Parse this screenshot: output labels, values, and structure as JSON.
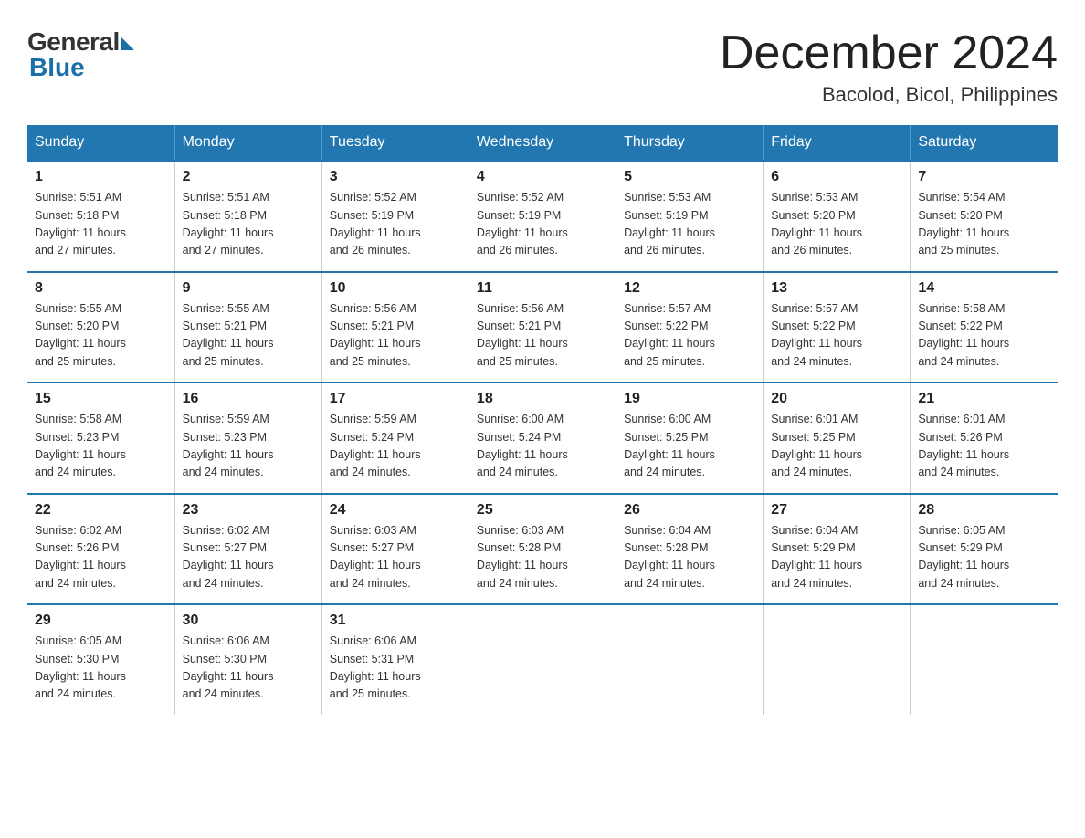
{
  "logo": {
    "general": "General",
    "blue": "Blue"
  },
  "title": "December 2024",
  "subtitle": "Bacolod, Bicol, Philippines",
  "headers": [
    "Sunday",
    "Monday",
    "Tuesday",
    "Wednesday",
    "Thursday",
    "Friday",
    "Saturday"
  ],
  "weeks": [
    [
      {
        "day": "1",
        "info": "Sunrise: 5:51 AM\nSunset: 5:18 PM\nDaylight: 11 hours\nand 27 minutes."
      },
      {
        "day": "2",
        "info": "Sunrise: 5:51 AM\nSunset: 5:18 PM\nDaylight: 11 hours\nand 27 minutes."
      },
      {
        "day": "3",
        "info": "Sunrise: 5:52 AM\nSunset: 5:19 PM\nDaylight: 11 hours\nand 26 minutes."
      },
      {
        "day": "4",
        "info": "Sunrise: 5:52 AM\nSunset: 5:19 PM\nDaylight: 11 hours\nand 26 minutes."
      },
      {
        "day": "5",
        "info": "Sunrise: 5:53 AM\nSunset: 5:19 PM\nDaylight: 11 hours\nand 26 minutes."
      },
      {
        "day": "6",
        "info": "Sunrise: 5:53 AM\nSunset: 5:20 PM\nDaylight: 11 hours\nand 26 minutes."
      },
      {
        "day": "7",
        "info": "Sunrise: 5:54 AM\nSunset: 5:20 PM\nDaylight: 11 hours\nand 25 minutes."
      }
    ],
    [
      {
        "day": "8",
        "info": "Sunrise: 5:55 AM\nSunset: 5:20 PM\nDaylight: 11 hours\nand 25 minutes."
      },
      {
        "day": "9",
        "info": "Sunrise: 5:55 AM\nSunset: 5:21 PM\nDaylight: 11 hours\nand 25 minutes."
      },
      {
        "day": "10",
        "info": "Sunrise: 5:56 AM\nSunset: 5:21 PM\nDaylight: 11 hours\nand 25 minutes."
      },
      {
        "day": "11",
        "info": "Sunrise: 5:56 AM\nSunset: 5:21 PM\nDaylight: 11 hours\nand 25 minutes."
      },
      {
        "day": "12",
        "info": "Sunrise: 5:57 AM\nSunset: 5:22 PM\nDaylight: 11 hours\nand 25 minutes."
      },
      {
        "day": "13",
        "info": "Sunrise: 5:57 AM\nSunset: 5:22 PM\nDaylight: 11 hours\nand 24 minutes."
      },
      {
        "day": "14",
        "info": "Sunrise: 5:58 AM\nSunset: 5:22 PM\nDaylight: 11 hours\nand 24 minutes."
      }
    ],
    [
      {
        "day": "15",
        "info": "Sunrise: 5:58 AM\nSunset: 5:23 PM\nDaylight: 11 hours\nand 24 minutes."
      },
      {
        "day": "16",
        "info": "Sunrise: 5:59 AM\nSunset: 5:23 PM\nDaylight: 11 hours\nand 24 minutes."
      },
      {
        "day": "17",
        "info": "Sunrise: 5:59 AM\nSunset: 5:24 PM\nDaylight: 11 hours\nand 24 minutes."
      },
      {
        "day": "18",
        "info": "Sunrise: 6:00 AM\nSunset: 5:24 PM\nDaylight: 11 hours\nand 24 minutes."
      },
      {
        "day": "19",
        "info": "Sunrise: 6:00 AM\nSunset: 5:25 PM\nDaylight: 11 hours\nand 24 minutes."
      },
      {
        "day": "20",
        "info": "Sunrise: 6:01 AM\nSunset: 5:25 PM\nDaylight: 11 hours\nand 24 minutes."
      },
      {
        "day": "21",
        "info": "Sunrise: 6:01 AM\nSunset: 5:26 PM\nDaylight: 11 hours\nand 24 minutes."
      }
    ],
    [
      {
        "day": "22",
        "info": "Sunrise: 6:02 AM\nSunset: 5:26 PM\nDaylight: 11 hours\nand 24 minutes."
      },
      {
        "day": "23",
        "info": "Sunrise: 6:02 AM\nSunset: 5:27 PM\nDaylight: 11 hours\nand 24 minutes."
      },
      {
        "day": "24",
        "info": "Sunrise: 6:03 AM\nSunset: 5:27 PM\nDaylight: 11 hours\nand 24 minutes."
      },
      {
        "day": "25",
        "info": "Sunrise: 6:03 AM\nSunset: 5:28 PM\nDaylight: 11 hours\nand 24 minutes."
      },
      {
        "day": "26",
        "info": "Sunrise: 6:04 AM\nSunset: 5:28 PM\nDaylight: 11 hours\nand 24 minutes."
      },
      {
        "day": "27",
        "info": "Sunrise: 6:04 AM\nSunset: 5:29 PM\nDaylight: 11 hours\nand 24 minutes."
      },
      {
        "day": "28",
        "info": "Sunrise: 6:05 AM\nSunset: 5:29 PM\nDaylight: 11 hours\nand 24 minutes."
      }
    ],
    [
      {
        "day": "29",
        "info": "Sunrise: 6:05 AM\nSunset: 5:30 PM\nDaylight: 11 hours\nand 24 minutes."
      },
      {
        "day": "30",
        "info": "Sunrise: 6:06 AM\nSunset: 5:30 PM\nDaylight: 11 hours\nand 24 minutes."
      },
      {
        "day": "31",
        "info": "Sunrise: 6:06 AM\nSunset: 5:31 PM\nDaylight: 11 hours\nand 25 minutes."
      },
      {
        "day": "",
        "info": ""
      },
      {
        "day": "",
        "info": ""
      },
      {
        "day": "",
        "info": ""
      },
      {
        "day": "",
        "info": ""
      }
    ]
  ]
}
